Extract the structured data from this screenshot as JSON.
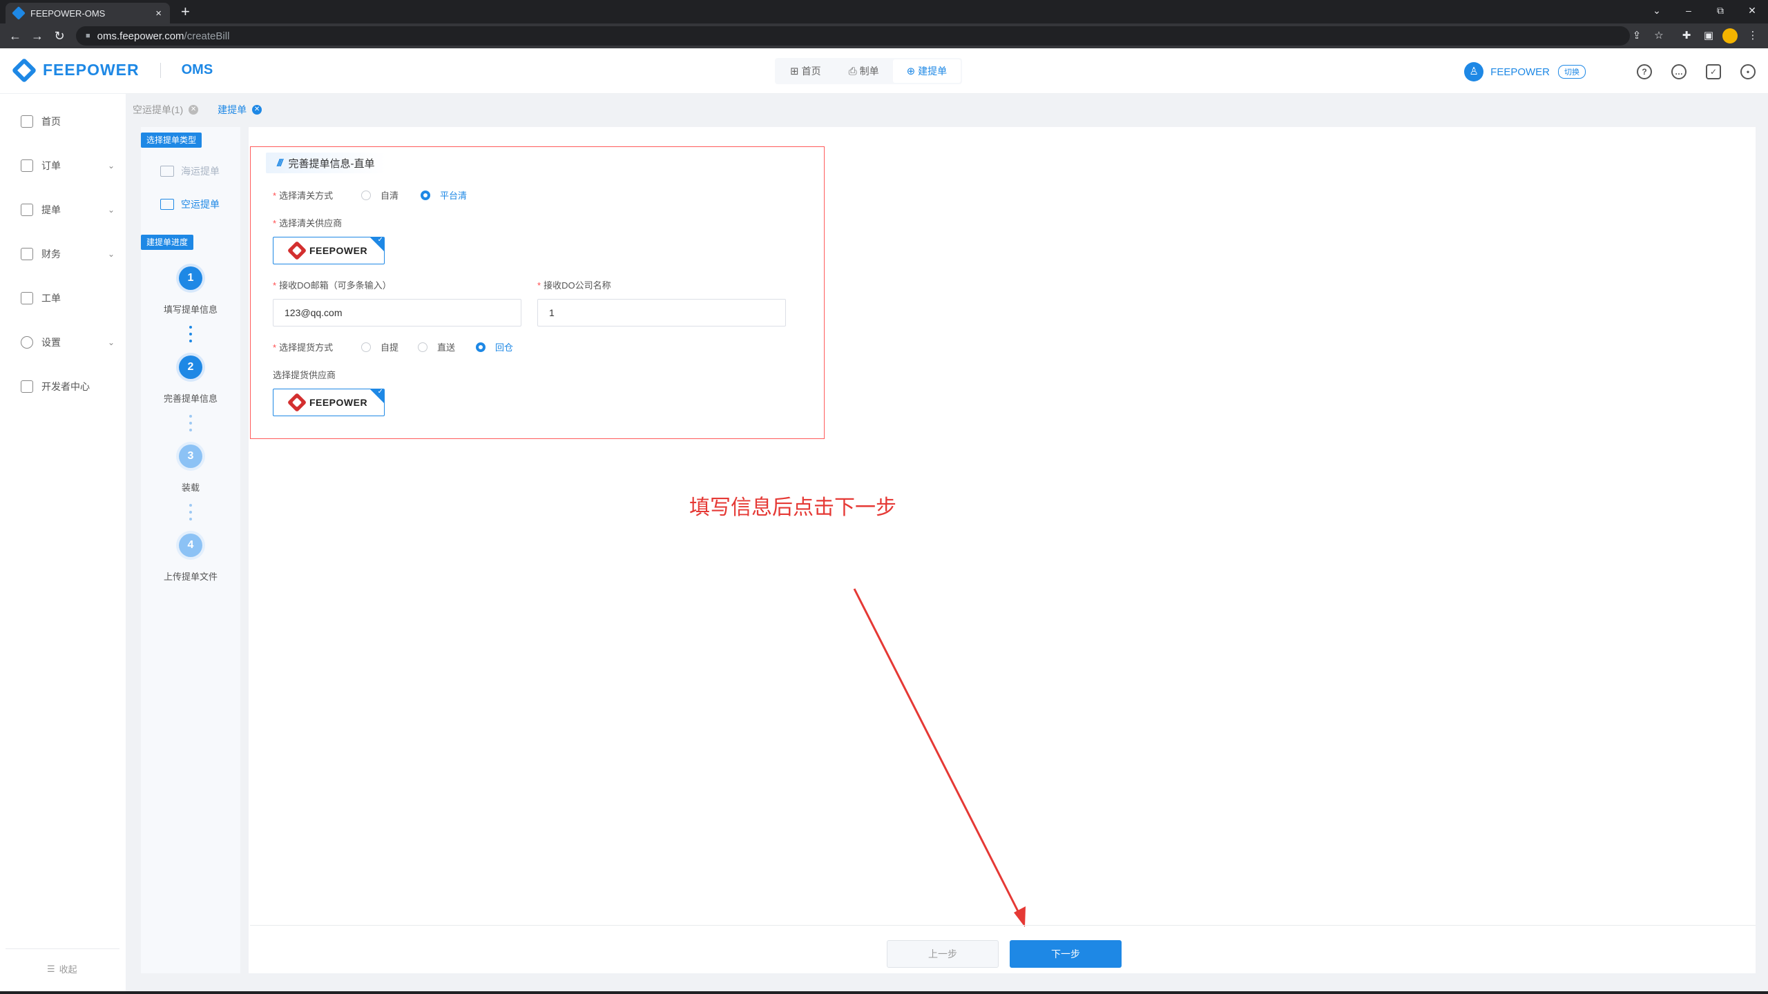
{
  "browser": {
    "tab_title": "FEEPOWER-OMS",
    "tab_close": "×",
    "new_tab": "+",
    "url_host": "oms.feepower.com",
    "url_path": "/createBill",
    "controls": {
      "dropdown": "⌄",
      "minimize": "–",
      "restore": "⧉",
      "close": "✕"
    },
    "nav": {
      "back": "←",
      "forward": "→",
      "reload": "↻"
    },
    "extension_icons": [
      "share-icon",
      "star-icon",
      "puzzle-icon",
      "sidepanel-icon",
      "profile-icon",
      "menu-icon"
    ]
  },
  "header": {
    "brand": "FEEPOWER",
    "product": "OMS",
    "nav": [
      {
        "icon": "grid-icon",
        "label": "首页"
      },
      {
        "icon": "doc-user-icon",
        "label": "制单"
      },
      {
        "icon": "doc-add-icon",
        "label": "建提单"
      }
    ],
    "active_nav": "建提单",
    "user_name": "FEEPOWER",
    "switch_label": "切换",
    "icons": [
      "help-icon",
      "message-icon",
      "calendar-icon",
      "user-icon"
    ]
  },
  "sidebar": {
    "items": [
      {
        "label": "首页",
        "icon": "home-icon",
        "chevron": ""
      },
      {
        "label": "订单",
        "icon": "order-icon",
        "chevron": "⌄"
      },
      {
        "label": "提单",
        "icon": "bill-icon",
        "chevron": "⌄"
      },
      {
        "label": "财务",
        "icon": "finance-icon",
        "chevron": "⌄"
      },
      {
        "label": "工单",
        "icon": "ticket-icon",
        "chevron": ""
      },
      {
        "label": "设置",
        "icon": "settings-icon",
        "chevron": "⌄"
      },
      {
        "label": "开发者中心",
        "icon": "developer-icon",
        "chevron": ""
      }
    ],
    "collapse_label": "收起"
  },
  "page_tabs": [
    {
      "label": "空运提单(1)",
      "active": false
    },
    {
      "label": "建提单",
      "active": true
    }
  ],
  "step_panel": {
    "type_tag": "选择提单类型",
    "types": [
      {
        "label": "海运提单",
        "active": false
      },
      {
        "label": "空运提单",
        "active": true
      }
    ],
    "progress_tag": "建提单进度",
    "steps": [
      {
        "num": "1",
        "label": "填写提单信息",
        "done": true
      },
      {
        "num": "2",
        "label": "完善提单信息",
        "done": true
      },
      {
        "num": "3",
        "label": "装载",
        "done": false
      },
      {
        "num": "4",
        "label": "上传提单文件",
        "done": false
      }
    ]
  },
  "form": {
    "section_title": "完善提单信息-直单",
    "customs_method": {
      "label": "选择清关方式",
      "options": [
        "自清",
        "平台清"
      ],
      "selected": "平台清"
    },
    "customs_vendor_label": "选择清关供应商",
    "vendor_name": "FEEPOWER",
    "do_email": {
      "label": "接收DO邮箱（可多条输入）",
      "value": "123@qq.com"
    },
    "do_company": {
      "label": "接收DO公司名称",
      "value": "1"
    },
    "pickup_method": {
      "label": "选择提货方式",
      "options": [
        "自提",
        "直送",
        "回仓"
      ],
      "selected": "回仓"
    },
    "pickup_vendor_label": "选择提货供应商"
  },
  "annotation": "填写信息后点击下一步",
  "buttons": {
    "prev": "上一步",
    "next": "下一步"
  },
  "colors": {
    "primary": "#1e88e5",
    "annotation": "#e53935",
    "required": "#ff4d4f"
  }
}
